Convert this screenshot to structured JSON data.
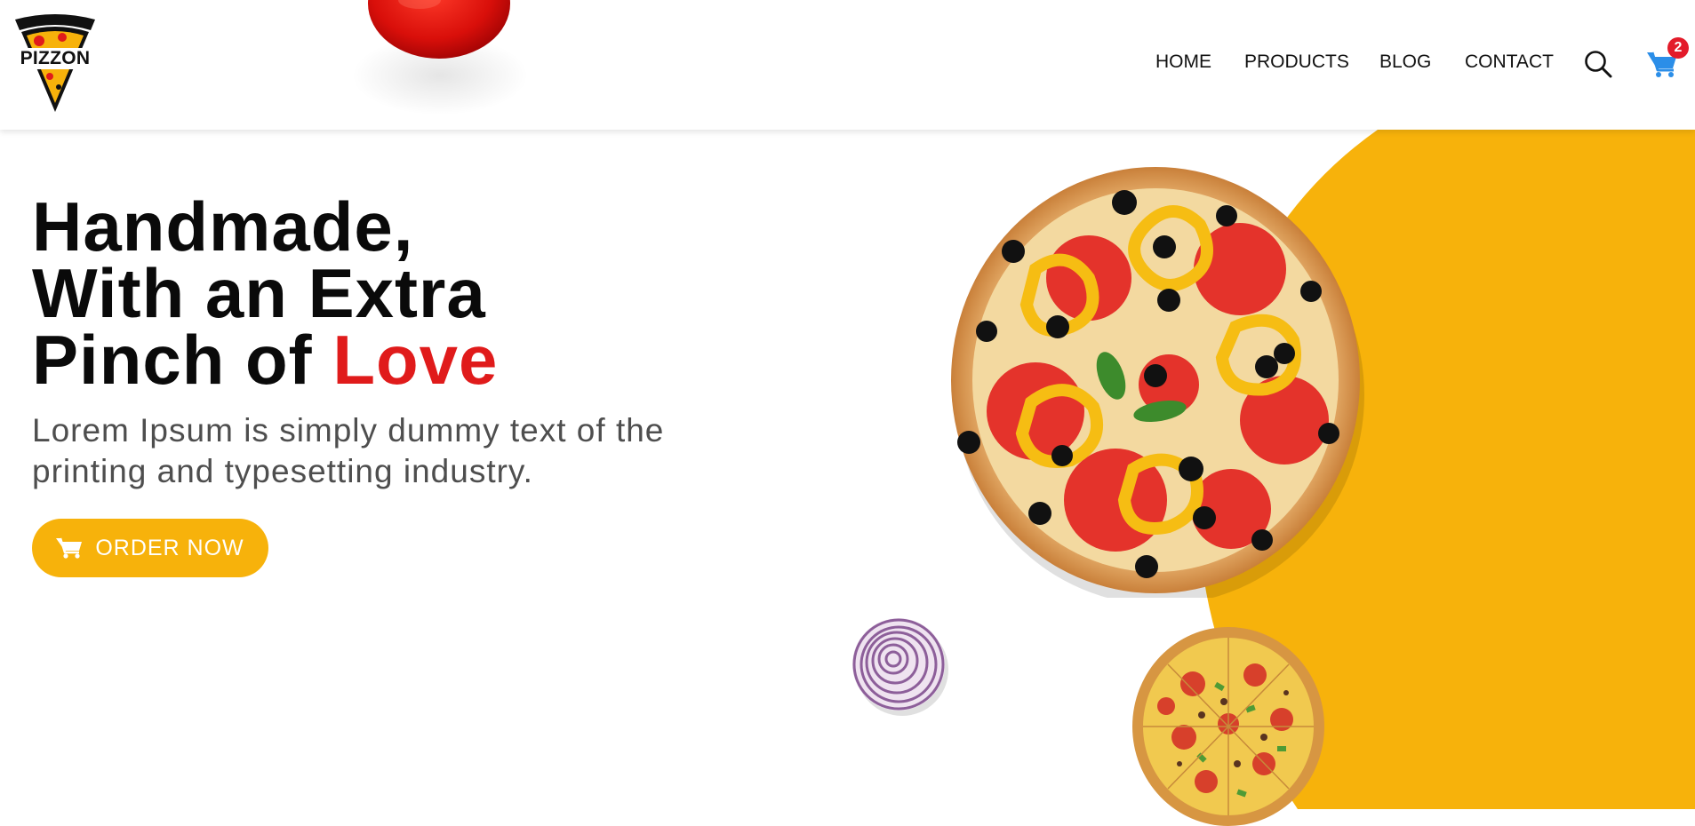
{
  "brand": {
    "name": "PIZZON",
    "accent": "#f7b20b",
    "highlight": "#e01b1b"
  },
  "nav": {
    "items": [
      {
        "label": "HOME"
      },
      {
        "label": "PRODUCTS"
      },
      {
        "label": "BLOG"
      },
      {
        "label": "CONTACT"
      }
    ],
    "search_icon": "search-icon",
    "cart_icon": "cart-icon",
    "cart_count": "2"
  },
  "hero": {
    "title_line1": "Handmade,",
    "title_line2": "With an Extra",
    "title_line3_prefix": "Pinch of ",
    "title_line3_highlight": "Love",
    "subtitle": "Lorem Ipsum is simply dummy text of the printing and typesetting industry.",
    "cta_label": "ORDER NOW",
    "cta_icon": "cart-icon"
  }
}
